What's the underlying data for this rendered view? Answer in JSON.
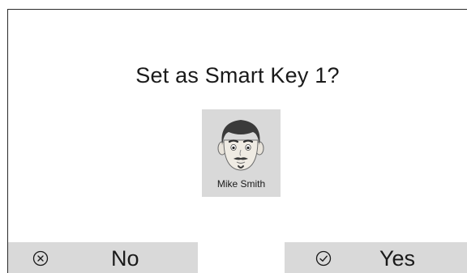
{
  "dialog": {
    "title": "Set as Smart Key 1?"
  },
  "profile": {
    "name": "Mike Smith",
    "avatar_icon": "male-face-avatar"
  },
  "buttons": {
    "no": {
      "label": "No",
      "icon": "circle-x-icon"
    },
    "yes": {
      "label": "Yes",
      "icon": "circle-check-icon"
    }
  },
  "colors": {
    "background": "#ffffff",
    "button_bg": "#d9d9d9",
    "text": "#1a1a1a"
  }
}
